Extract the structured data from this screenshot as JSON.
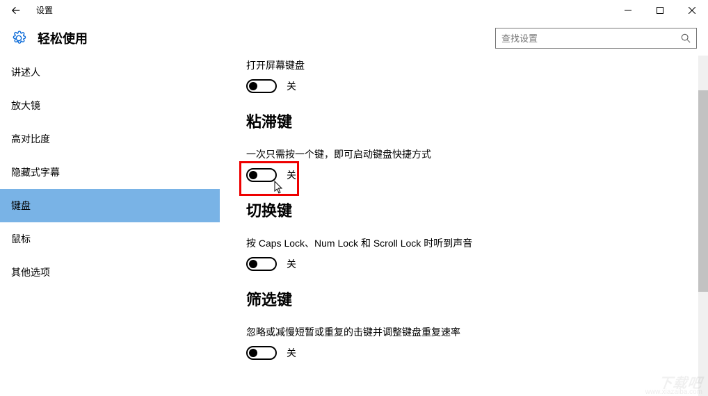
{
  "titlebar": {
    "title": "设置"
  },
  "header": {
    "section_title": "轻松使用",
    "search_placeholder": "查找设置"
  },
  "sidebar": {
    "items": [
      {
        "label": "讲述人",
        "selected": false
      },
      {
        "label": "放大镜",
        "selected": false
      },
      {
        "label": "高对比度",
        "selected": false
      },
      {
        "label": "隐藏式字幕",
        "selected": false
      },
      {
        "label": "键盘",
        "selected": true
      },
      {
        "label": "鼠标",
        "selected": false
      },
      {
        "label": "其他选项",
        "selected": false
      }
    ]
  },
  "content": {
    "screen_keyboard": {
      "desc": "打开屏幕键盘",
      "state_label": "关",
      "on": false
    },
    "sticky_keys": {
      "heading": "粘滞键",
      "desc": "一次只需按一个键，即可启动键盘快捷方式",
      "state_label": "关",
      "on": false
    },
    "toggle_keys": {
      "heading": "切换键",
      "desc": "按 Caps Lock、Num Lock 和 Scroll Lock 时听到声音",
      "state_label": "关",
      "on": false
    },
    "filter_keys": {
      "heading": "筛选键",
      "desc": "忽略或减慢短暂或重复的击键并调整键盘重复速率",
      "state_label": "关",
      "on": false
    }
  },
  "watermark": {
    "main": "下载吧",
    "sub": "www.xiazaiba.com"
  }
}
